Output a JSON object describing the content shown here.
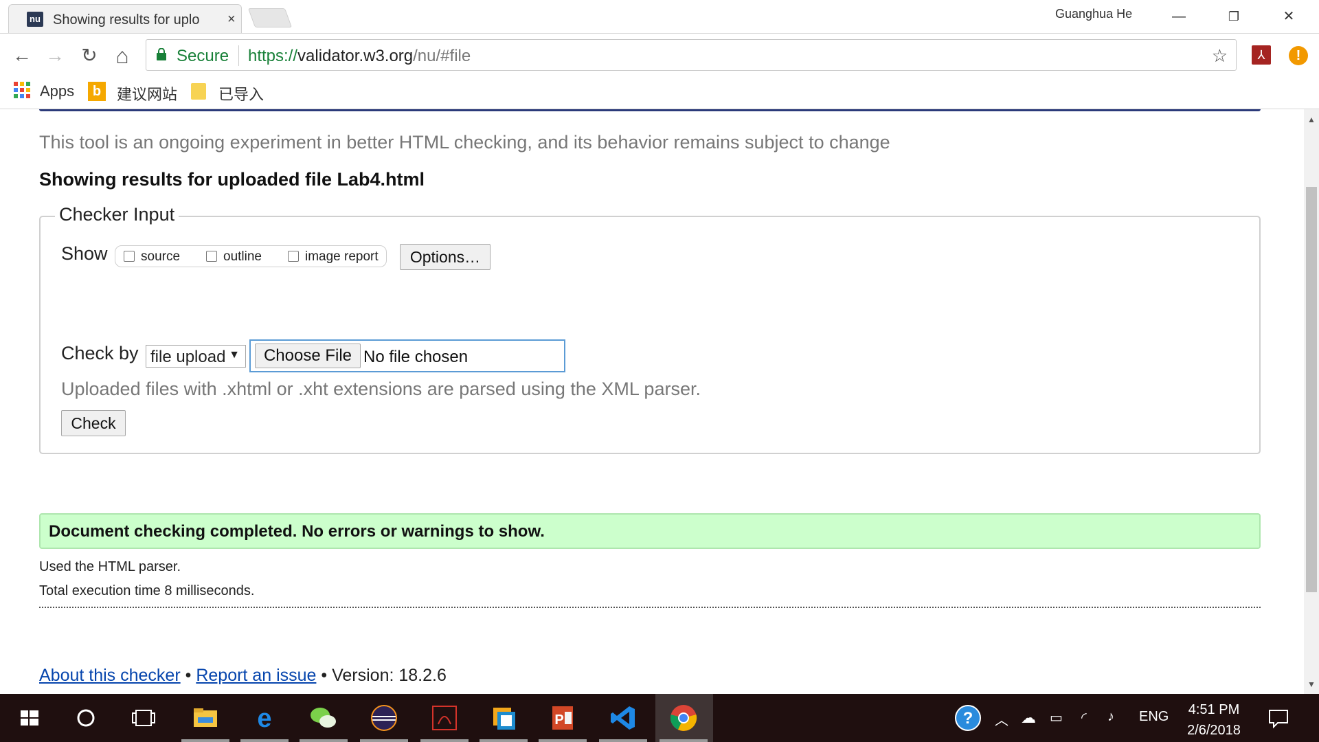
{
  "browser": {
    "tab_title": "Showing results for uplo",
    "tab_close": "×",
    "favicon_text": "nu",
    "profile_name": "Guanghua He",
    "window_buttons": {
      "minimize": "—",
      "restore": "❐",
      "close": "✕"
    },
    "nav": {
      "back": "←",
      "forward": "→",
      "reload": "↻",
      "home": "⌂"
    },
    "secure_label": "Secure",
    "url_scheme": "https://",
    "url_host": "validator.w3.org",
    "url_path": "/nu/#file",
    "bookmark_star": "☆",
    "extensions": {
      "pdf_icon": "pdf-extension-icon",
      "warning_symbol": "!"
    }
  },
  "bookmarks": [
    {
      "label": "Apps",
      "icon": "apps-grid-icon"
    },
    {
      "label": "建议网站",
      "icon": "bing-icon"
    },
    {
      "label": "已导入",
      "icon": "folder-icon"
    }
  ],
  "page": {
    "tagline": "This tool is an ongoing experiment in better HTML checking, and its behavior remains subject to change",
    "results_heading": "Showing results for uploaded file Lab4.html",
    "checker_input_legend": "Checker Input",
    "show_label": "Show",
    "show_options": [
      {
        "label": "source",
        "checked": false
      },
      {
        "label": "outline",
        "checked": false
      },
      {
        "label": "image report",
        "checked": false
      }
    ],
    "options_button": "Options…",
    "check_by_label": "Check by",
    "check_by_value": "file upload",
    "select_caret": "▼",
    "choose_file_button": "Choose File",
    "no_file_text": "No file chosen",
    "parser_note": "Uploaded files with .xhtml or .xht extensions are parsed using the XML parser.",
    "check_button": "Check",
    "success_message": "Document checking completed. No errors or warnings to show.",
    "parser_used": "Used the HTML parser.",
    "execution_time": "Total execution time 8 milliseconds.",
    "footer": {
      "about_link": "About this checker",
      "separator": " • ",
      "report_link": "Report an issue",
      "version_text": "Version: 18.2.6"
    }
  },
  "taskbar": {
    "clock_time": "4:51 PM",
    "clock_date": "2/6/2018",
    "language": "ENG",
    "pinned_apps": [
      "start",
      "cortana",
      "task-view",
      "file-explorer",
      "edge",
      "wechat",
      "eclipse",
      "acrobat",
      "vmware",
      "powerpoint",
      "vscode",
      "chrome"
    ]
  },
  "colors": {
    "secure_green": "#188038",
    "link_blue": "#0645ad",
    "success_bg": "#ccffcc",
    "taskbar_bg": "#1f0f0f",
    "header_rule": "#2b3a7a"
  }
}
